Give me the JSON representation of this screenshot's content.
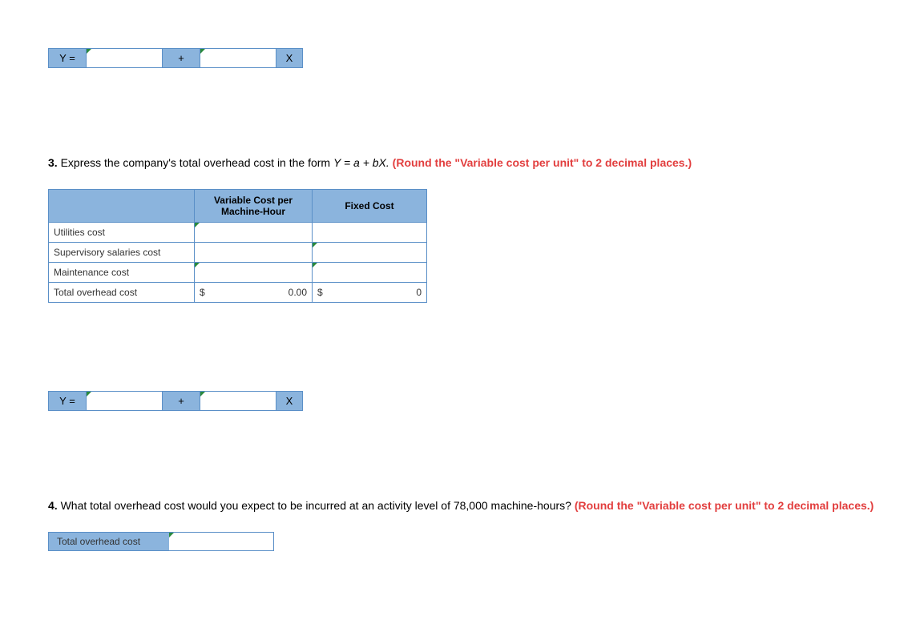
{
  "formula1": {
    "y_label": "Y =",
    "plus": "+",
    "x_label": "X",
    "input_a": "",
    "input_b": ""
  },
  "question3": {
    "number": "3.",
    "text": "Express the company's total overhead cost in the form",
    "formula_text": "Y = a + bX.",
    "redtext": "(Round the \"Variable cost per unit\" to 2 decimal places.)"
  },
  "cost_table": {
    "headers": {
      "blank": "",
      "variable": "Variable Cost per Machine-Hour",
      "fixed": "Fixed Cost"
    },
    "rows": [
      {
        "label": "Utilities cost",
        "var": "",
        "fix": "",
        "var_tri": true,
        "fix_tri": false
      },
      {
        "label": "Supervisory salaries cost",
        "var": "",
        "fix": "",
        "var_tri": false,
        "fix_tri": true
      },
      {
        "label": "Maintenance cost",
        "var": "",
        "fix": "",
        "var_tri": true,
        "fix_tri": true
      }
    ],
    "total": {
      "label": "Total overhead cost",
      "var_sym": "$",
      "var_val": "0.00",
      "fix_sym": "$",
      "fix_val": "0"
    }
  },
  "formula2": {
    "y_label": "Y =",
    "plus": "+",
    "x_label": "X",
    "input_a": "",
    "input_b": ""
  },
  "question4": {
    "number": "4.",
    "text_a": "What total overhead cost would you expect to be incurred at an activity level of 78,000 machine-hours?",
    "redtext": "(Round the \"Variable cost per unit\" to 2 decimal places.)"
  },
  "overhead_row": {
    "label": "Total overhead cost",
    "value": ""
  }
}
